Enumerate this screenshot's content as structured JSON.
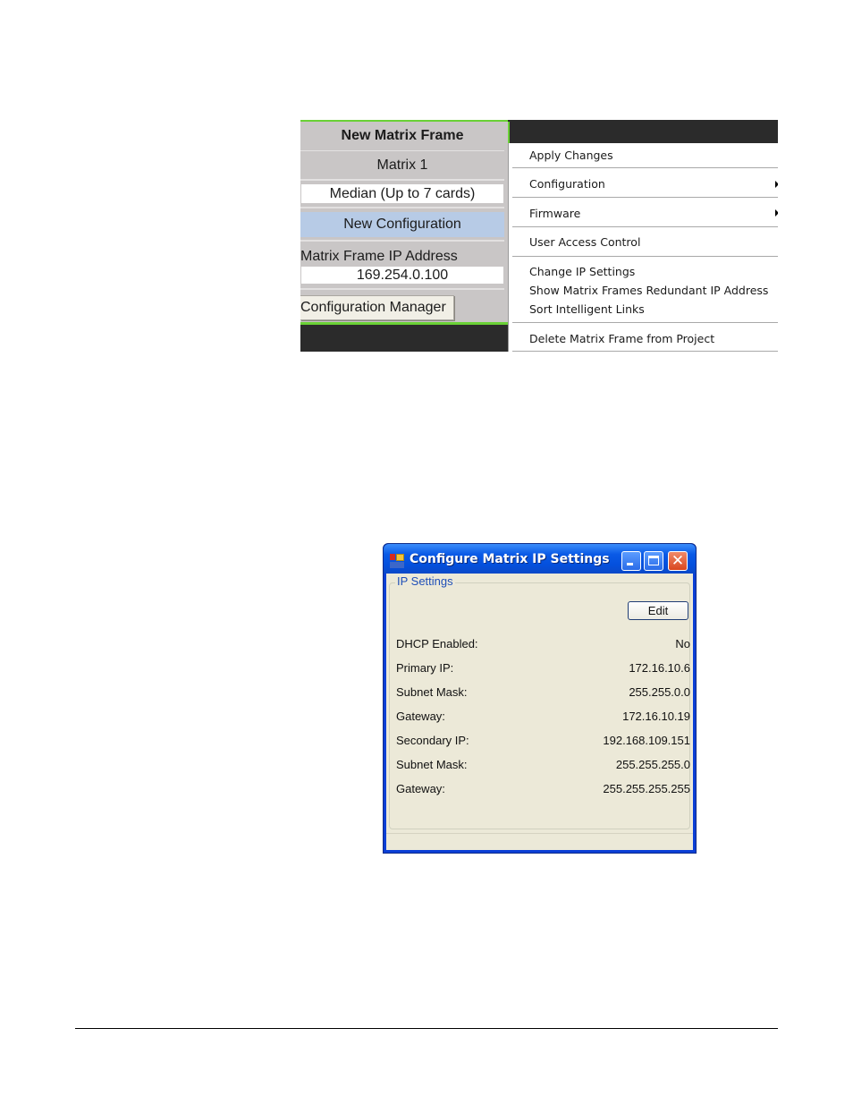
{
  "figure1": {
    "panel": {
      "title": "New Matrix Frame",
      "matrix_name": "Matrix 1",
      "frame_type": "Median (Up to 7 cards)",
      "configuration": "New Configuration",
      "ip_label": "Matrix Frame IP Address",
      "ip_value": "169.254.0.100",
      "config_manager_button": "Configuration Manager",
      "accent_color": "#6ad136",
      "selected_color": "#b7cbe6"
    },
    "context_menu": {
      "items": [
        {
          "label": "Apply Changes",
          "submenu": false
        },
        {
          "label": "Configuration",
          "submenu": true
        },
        {
          "label": "Firmware",
          "submenu": true
        },
        {
          "label": "User Access Control",
          "submenu": false
        },
        {
          "label": "Change IP Settings",
          "submenu": false
        },
        {
          "label": "Show Matrix Frames Redundant IP Address",
          "submenu": false
        },
        {
          "label": "Sort Intelligent Links",
          "submenu": false
        },
        {
          "label": "Delete Matrix Frame from Project",
          "submenu": false
        }
      ]
    }
  },
  "figure2": {
    "window": {
      "title": "Configure Matrix IP Settings",
      "icon": "app-window-icon",
      "controls": {
        "minimize": "minimize-icon",
        "maximize": "maximize-icon",
        "close": "close-icon"
      },
      "close_glyph": "✕"
    },
    "group": {
      "legend": "IP Settings",
      "edit_button": "Edit",
      "fields": [
        {
          "label": "DHCP Enabled:",
          "value": "No"
        },
        {
          "label": "Primary IP:",
          "value": "172.16.10.6"
        },
        {
          "label": "Subnet Mask:",
          "value": "255.255.0.0"
        },
        {
          "label": "Gateway:",
          "value": "172.16.10.19"
        },
        {
          "label": "Secondary IP:",
          "value": "192.168.109.151"
        },
        {
          "label": "Subnet Mask:",
          "value": "255.255.255.0"
        },
        {
          "label": "Gateway:",
          "value": "255.255.255.255"
        }
      ]
    }
  }
}
